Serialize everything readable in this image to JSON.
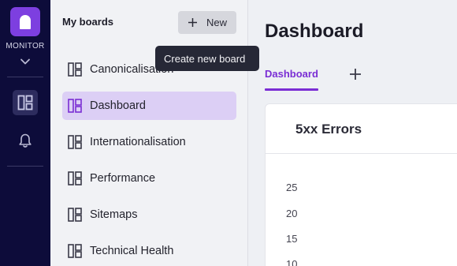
{
  "rail": {
    "app_name": "MONITOR",
    "items": [
      {
        "icon": "dashboard-icon",
        "active": true
      },
      {
        "icon": "bell-icon",
        "active": false
      }
    ]
  },
  "boards_panel": {
    "title": "My boards",
    "new_button_label": "New",
    "tooltip": "Create new board",
    "boards": [
      {
        "label": "Canonicalisation",
        "selected": false
      },
      {
        "label": "Dashboard",
        "selected": true
      },
      {
        "label": "Internationalisation",
        "selected": false
      },
      {
        "label": "Performance",
        "selected": false
      },
      {
        "label": "Sitemaps",
        "selected": false
      },
      {
        "label": "Technical Health",
        "selected": false
      }
    ]
  },
  "main": {
    "page_title": "Dashboard",
    "tabs": [
      {
        "label": "Dashboard",
        "active": true
      }
    ],
    "card": {
      "title": "5xx Errors",
      "y_ticks": [
        "25",
        "20",
        "15",
        "10"
      ]
    }
  },
  "colors": {
    "accent": "#7a2dd4",
    "rail_bg": "#0d0c3a",
    "selected_board_bg": "#dccff5",
    "tooltip_bg": "#262836"
  }
}
